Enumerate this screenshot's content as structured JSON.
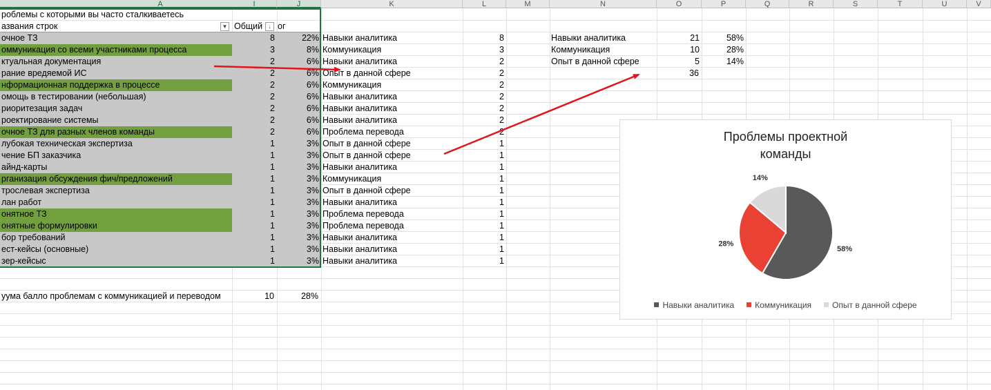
{
  "columns": [
    "A",
    "I",
    "J",
    "K",
    "L",
    "M",
    "N",
    "O",
    "P",
    "Q",
    "R",
    "S",
    "T",
    "U",
    "V"
  ],
  "pivot": {
    "title": "роблемы с которыми вы часто сталкиваетесь",
    "header_label": "азвания строк",
    "header_total": "Общий",
    "header_sort_glyph": "↓",
    "header_pct": "ог",
    "rows": [
      {
        "label": "очное ТЗ",
        "count": "8",
        "pct": "22%",
        "fill": "gray"
      },
      {
        "label": "оммуникация со всеми участниками процесса",
        "count": "3",
        "pct": "8%",
        "fill": "green"
      },
      {
        "label": "ктуальная документация",
        "count": "2",
        "pct": "6%",
        "fill": "gray"
      },
      {
        "label": "рание вредяемой ИС",
        "count": "2",
        "pct": "6%",
        "fill": "gray"
      },
      {
        "label": "нформационная поддержка в процессе",
        "count": "2",
        "pct": "6%",
        "fill": "green"
      },
      {
        "label": "омощь в тестировании (небольшая)",
        "count": "2",
        "pct": "6%",
        "fill": "gray"
      },
      {
        "label": "риоритезация задач",
        "count": "2",
        "pct": "6%",
        "fill": "gray"
      },
      {
        "label": "роектирование системы",
        "count": "2",
        "pct": "6%",
        "fill": "gray"
      },
      {
        "label": "очное ТЗ для разных членов команды",
        "count": "2",
        "pct": "6%",
        "fill": "green"
      },
      {
        "label": "лубокая техническая экспертиза",
        "count": "1",
        "pct": "3%",
        "fill": "gray"
      },
      {
        "label": "чение БП заказчика",
        "count": "1",
        "pct": "3%",
        "fill": "gray"
      },
      {
        "label": "айнд-карты",
        "count": "1",
        "pct": "3%",
        "fill": "gray"
      },
      {
        "label": "рганизация обсуждения фич/предложений",
        "count": "1",
        "pct": "3%",
        "fill": "green"
      },
      {
        "label": "трослевая экспертиза",
        "count": "1",
        "pct": "3%",
        "fill": "gray"
      },
      {
        "label": "лан работ",
        "count": "1",
        "pct": "3%",
        "fill": "gray"
      },
      {
        "label": "онятное ТЗ",
        "count": "1",
        "pct": "3%",
        "fill": "green"
      },
      {
        "label": "онятные формулировки",
        "count": "1",
        "pct": "3%",
        "fill": "green"
      },
      {
        "label": "бор требований",
        "count": "1",
        "pct": "3%",
        "fill": "gray"
      },
      {
        "label": "ест-кейсы (основные)",
        "count": "1",
        "pct": "3%",
        "fill": "gray"
      },
      {
        "label": "зер-кейсыс",
        "count": "1",
        "pct": "3%",
        "fill": "gray"
      }
    ]
  },
  "categories_k": [
    {
      "label": "Навыки аналитика",
      "value": "8"
    },
    {
      "label": "Коммуникация",
      "value": "3"
    },
    {
      "label": "Навыки аналитика",
      "value": "2"
    },
    {
      "label": "Опыт в данной сфере",
      "value": "2"
    },
    {
      "label": "Коммуникация",
      "value": "2"
    },
    {
      "label": "Навыки аналитика",
      "value": "2"
    },
    {
      "label": "Навыки аналитика",
      "value": "2"
    },
    {
      "label": "Навыки аналитика",
      "value": "2"
    },
    {
      "label": "Проблема перевода",
      "value": "2"
    },
    {
      "label": "Опыт в данной сфере",
      "value": "1"
    },
    {
      "label": "Опыт в данной сфере",
      "value": "1"
    },
    {
      "label": "Навыки аналитика",
      "value": "1"
    },
    {
      "label": "Коммуникация",
      "value": "1"
    },
    {
      "label": "Опыт в данной сфере",
      "value": "1"
    },
    {
      "label": "Навыки аналитика",
      "value": "1"
    },
    {
      "label": "Проблема перевода",
      "value": "1"
    },
    {
      "label": "Проблема перевода",
      "value": "1"
    },
    {
      "label": "Навыки аналитика",
      "value": "1"
    },
    {
      "label": "Навыки аналитика",
      "value": "1"
    },
    {
      "label": "Навыки аналитика",
      "value": "1"
    }
  ],
  "summary_n": [
    {
      "label": "Навыки аналитика",
      "count": "21",
      "pct": "58%"
    },
    {
      "label": "Коммуникация",
      "count": "10",
      "pct": "28%"
    },
    {
      "label": "Опыт в данной сфере",
      "count": "5",
      "pct": "14%"
    }
  ],
  "summary_total": "36",
  "footer": {
    "label": "уума балло проблемам с коммуникацией и переводом",
    "count": "10",
    "pct": "28%"
  },
  "colors": {
    "green": "#72a03e",
    "gray": "#c8c8c8",
    "arrow": "#e0141a",
    "selection": "#217346"
  },
  "chart_data": {
    "type": "pie",
    "title": "Проблемы проектной команды",
    "categories": [
      "Навыки аналитика",
      "Коммуникация",
      "Опыт в данной сфере"
    ],
    "values": [
      21,
      10,
      5
    ],
    "percent_labels": [
      "58%",
      "28%",
      "14%"
    ],
    "colors": [
      "#595959",
      "#e94235",
      "#d9d9d9"
    ],
    "legend_position": "bottom"
  }
}
